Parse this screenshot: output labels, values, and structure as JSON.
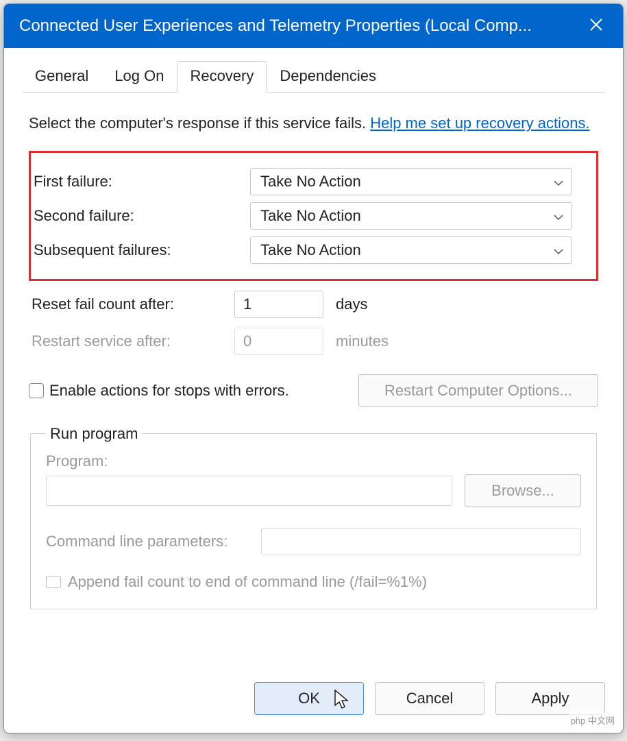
{
  "window": {
    "title": "Connected User Experiences and Telemetry Properties (Local Comp..."
  },
  "tabs": {
    "general": "General",
    "logon": "Log On",
    "recovery": "Recovery",
    "dependencies": "Dependencies",
    "active": "recovery"
  },
  "recovery": {
    "intro": "Select the computer's response if this service fails.",
    "help_link": "Help me set up recovery actions.",
    "first_failure_label": "First failure:",
    "second_failure_label": "Second failure:",
    "subsequent_failures_label": "Subsequent failures:",
    "first_failure_value": "Take No Action",
    "second_failure_value": "Take No Action",
    "subsequent_failures_value": "Take No Action",
    "reset_fail_label": "Reset fail count after:",
    "reset_fail_value": "1",
    "reset_fail_unit": "days",
    "restart_service_label": "Restart service after:",
    "restart_service_value": "0",
    "restart_service_unit": "minutes",
    "enable_actions_label": "Enable actions for stops with errors.",
    "restart_computer_options": "Restart Computer Options...",
    "run_program": {
      "legend": "Run program",
      "program_label": "Program:",
      "program_value": "",
      "browse": "Browse...",
      "cmd_params_label": "Command line parameters:",
      "cmd_params_value": "",
      "append_label": "Append fail count to end of command line (/fail=%1%)"
    }
  },
  "buttons": {
    "ok": "OK",
    "cancel": "Cancel",
    "apply": "Apply"
  },
  "watermark": "php 中文网"
}
